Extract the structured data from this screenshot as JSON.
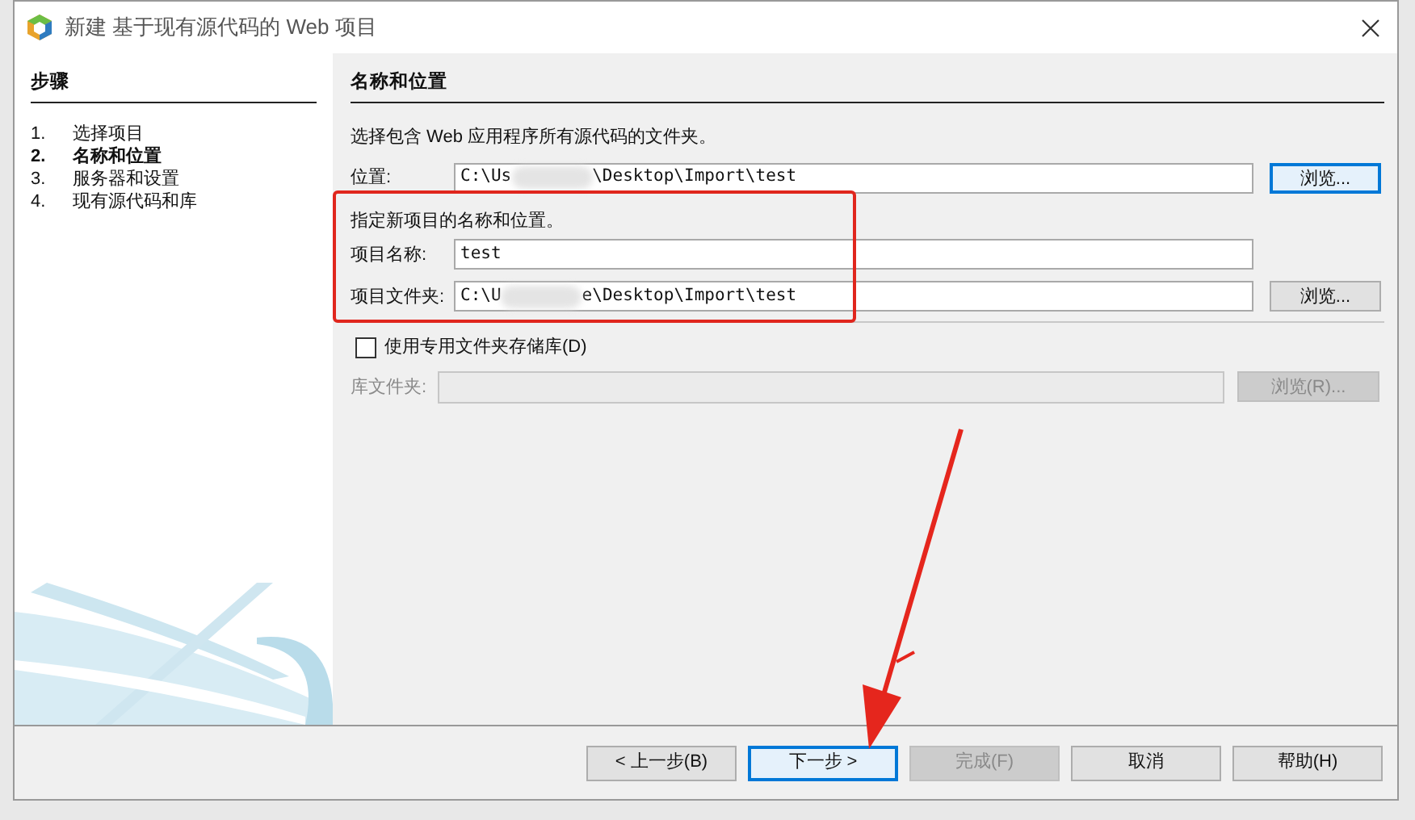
{
  "window": {
    "title": "新建 基于现有源代码的 Web 项目"
  },
  "steps": {
    "title": "步骤",
    "items": [
      {
        "number": "1.",
        "label": "选择项目",
        "selected": false
      },
      {
        "number": "2.",
        "label": "名称和位置",
        "selected": true
      },
      {
        "number": "3.",
        "label": "服务器和设置",
        "selected": false
      },
      {
        "number": "4.",
        "label": "现有源代码和库",
        "selected": false
      }
    ]
  },
  "panel": {
    "title": "名称和位置",
    "intro": "选择包含 Web 应用程序所有源代码的文件夹。",
    "location": {
      "label": "位置:",
      "value_start": "C:\\Us",
      "value_end": "\\Desktop\\Import\\test",
      "button": "浏览..."
    },
    "project_hint": "指定新项目的名称和位置。",
    "project_name": {
      "label": "项目名称:",
      "value": "test"
    },
    "project_folder": {
      "label": "项目文件夹:",
      "value_start": "C:\\U",
      "value_end": "e\\Desktop\\Import\\test",
      "button": "浏览..."
    },
    "dedicated_folder": {
      "label": "使用专用文件夹存储库(D)",
      "checked": false
    },
    "library_folder": {
      "label": "库文件夹:",
      "disabled": true,
      "button": "浏览(R)..."
    }
  },
  "buttons": [
    {
      "label": "< 上一步(B)",
      "disabled": false,
      "selected": false
    },
    {
      "label": "下一步 >",
      "disabled": false,
      "selected": true
    },
    {
      "label": "完成(F)",
      "disabled": true,
      "selected": false
    },
    {
      "label": "取消",
      "disabled": false,
      "selected": false
    },
    {
      "label": "帮助(H)",
      "disabled": false,
      "selected": false
    }
  ]
}
